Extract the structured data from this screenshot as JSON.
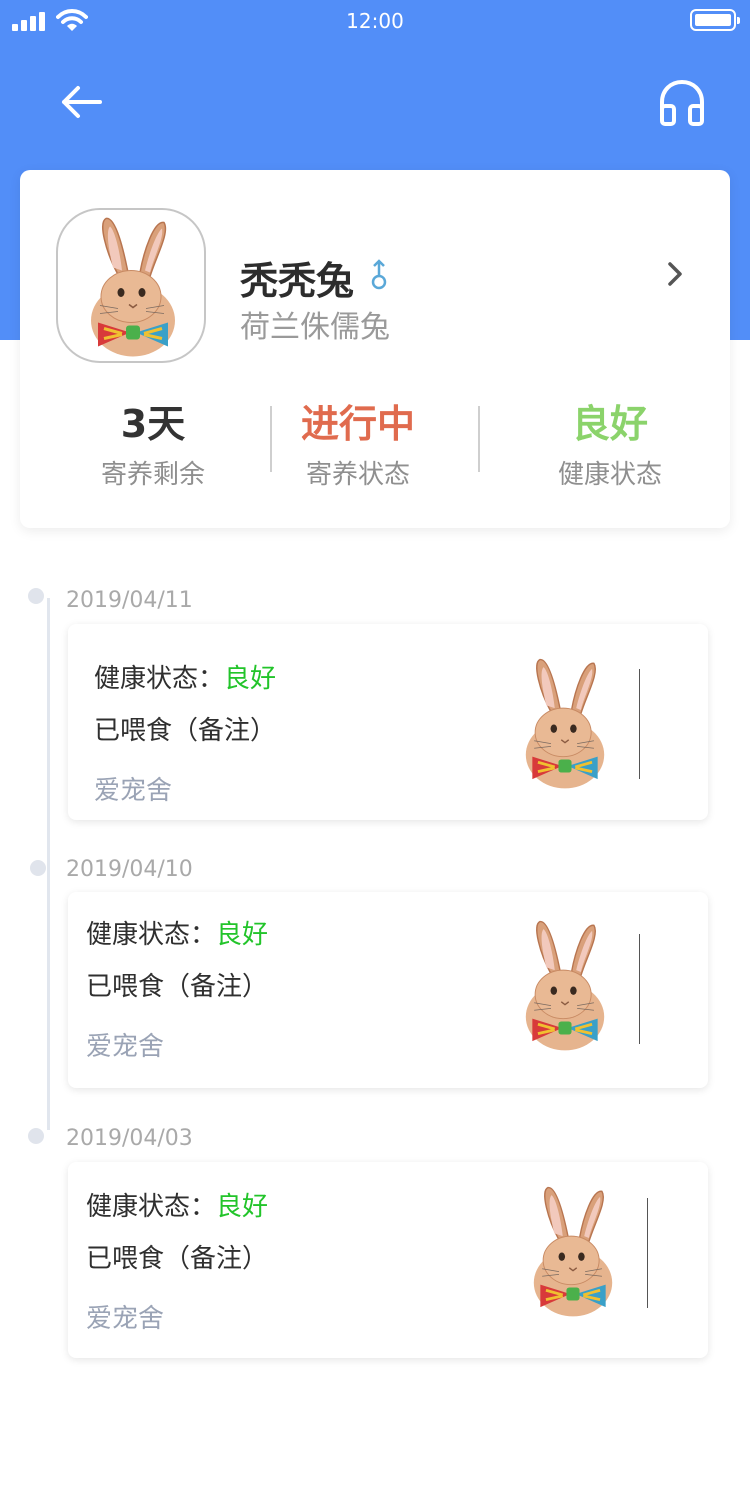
{
  "status_bar": {
    "time": "12:00"
  },
  "header": {
    "back_icon": "arrow-left-icon",
    "support_icon": "headphones-icon",
    "color": "#528ef8"
  },
  "pet": {
    "name": "秃秃兔",
    "gender_symbol": "♂",
    "breed": "荷兰侏儒兔"
  },
  "stats": [
    {
      "value": "3天",
      "label": "寄养剩余",
      "color": "#333333"
    },
    {
      "value": "进行中",
      "label": "寄养状态",
      "color": "#e06b4e"
    },
    {
      "value": "良好",
      "label": "健康状态",
      "color": "#8bd36b"
    }
  ],
  "timeline": [
    {
      "date": "2019/04/11",
      "health_label": "健康状态：",
      "health_value": "良好",
      "feed_note": "已喂食（备注）",
      "shop": "爱宠舍"
    },
    {
      "date": "2019/04/10",
      "health_label": "健康状态：",
      "health_value": "良好",
      "feed_note": "已喂食（备注）",
      "shop": "爱宠舍"
    },
    {
      "date": "2019/04/03",
      "health_label": "健康状态：",
      "health_value": "良好",
      "feed_note": "已喂食（备注）",
      "shop": "爱宠舍"
    }
  ],
  "colors": {
    "healthy_green": "#22c42a",
    "shop_gray": "#9aa3b5"
  }
}
